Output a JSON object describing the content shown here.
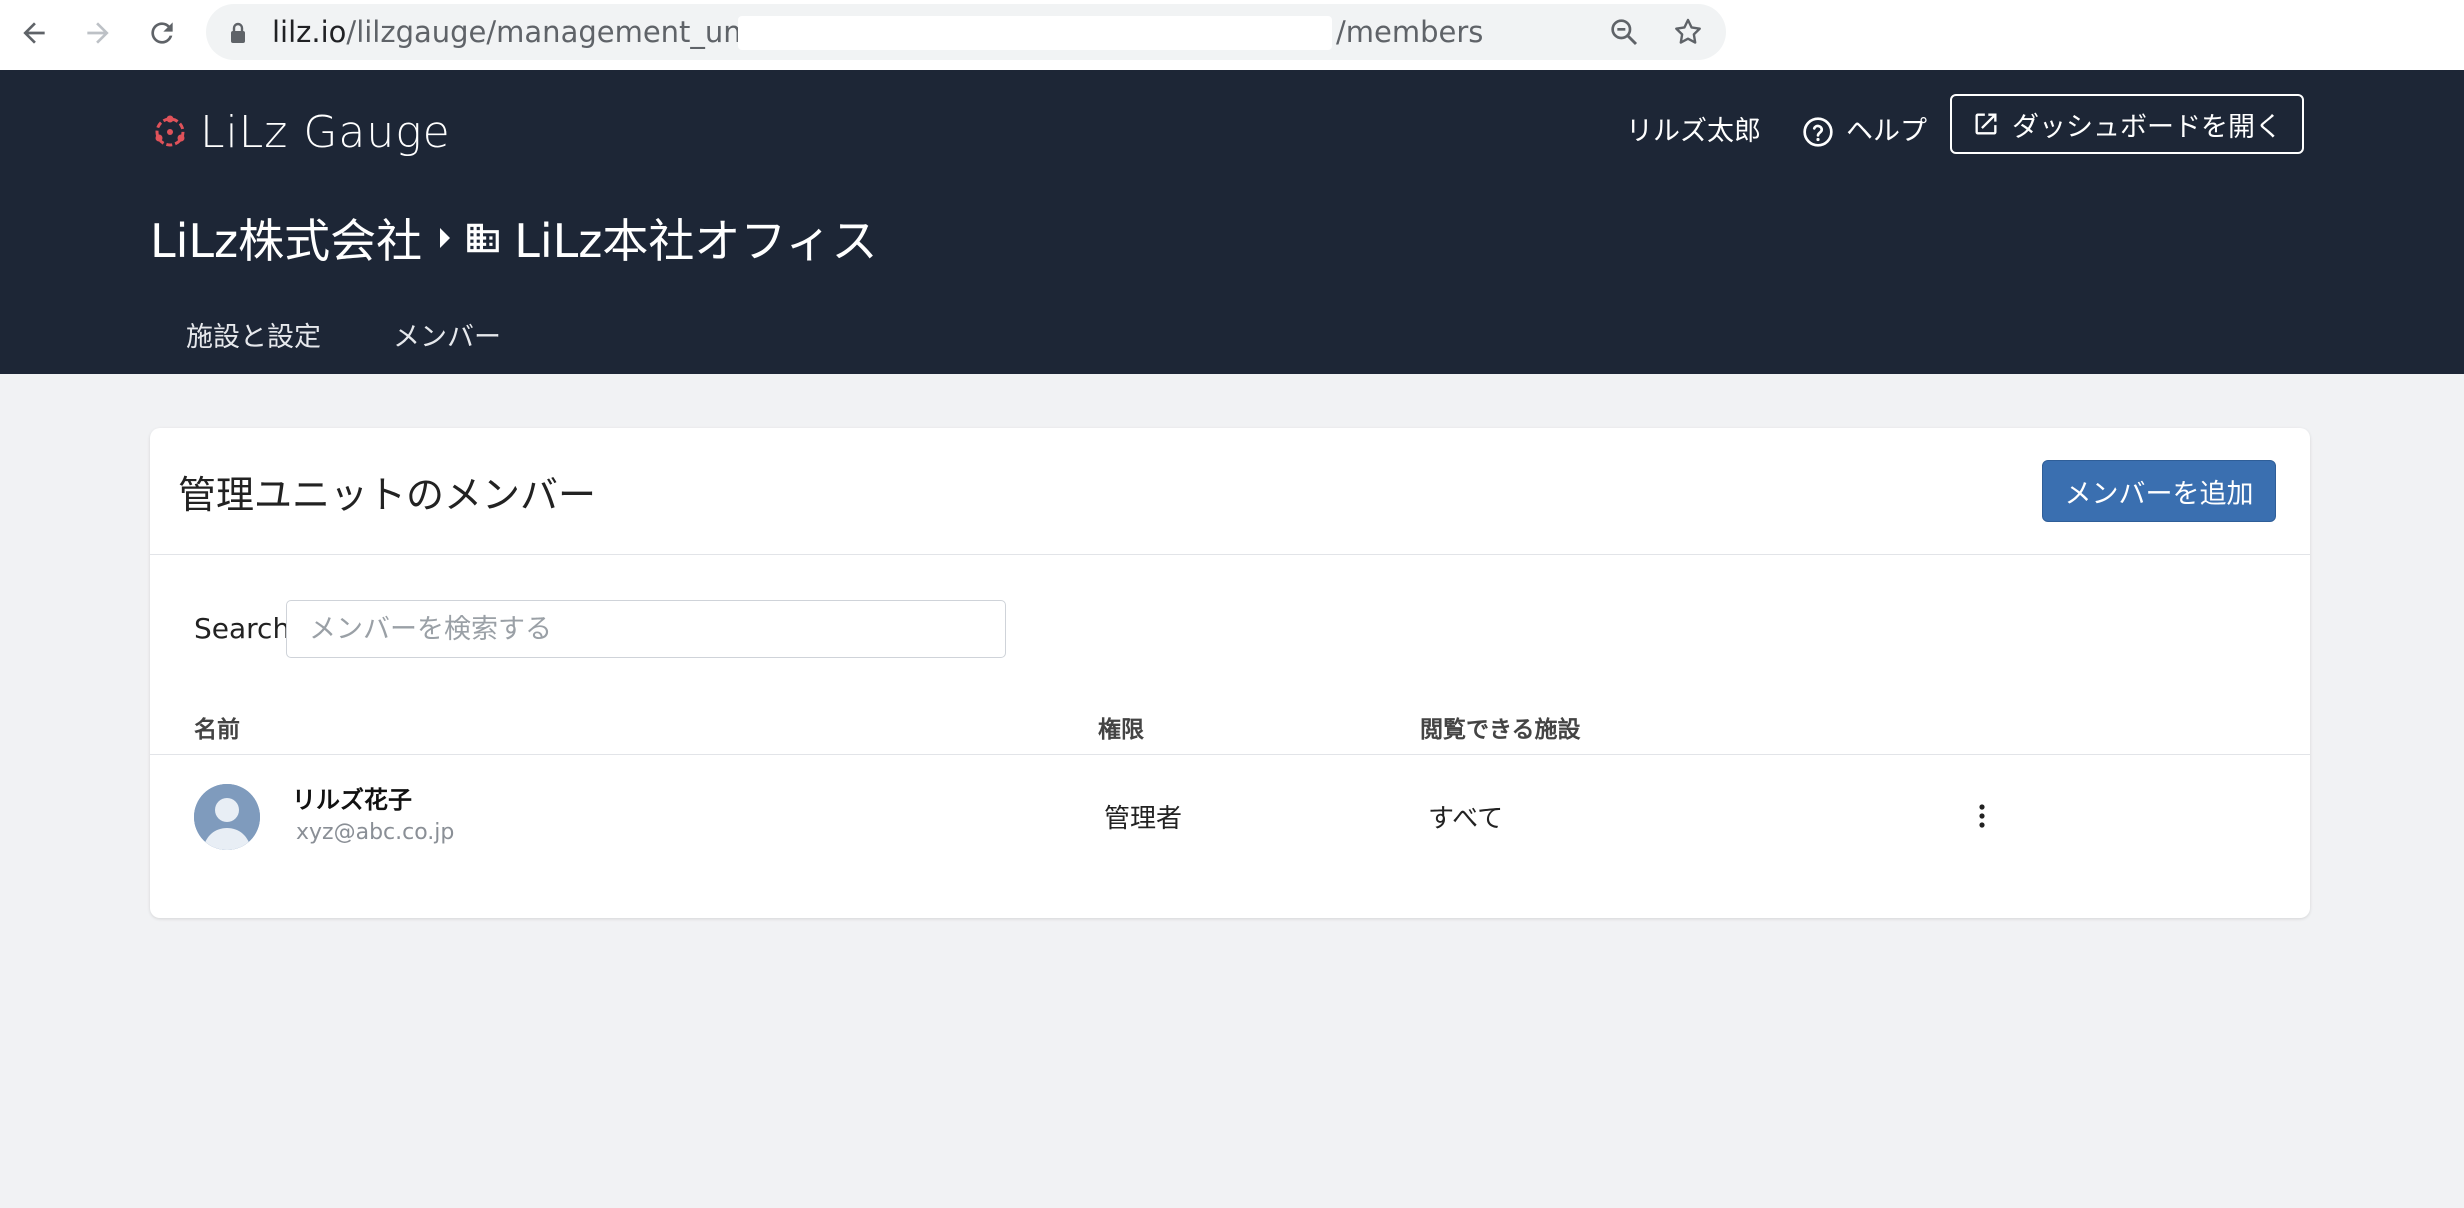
{
  "browser": {
    "url_host": "lilz.io",
    "url_path": "/lilzgauge/management_units/",
    "url_tail": "/members",
    "icons": [
      "back-icon",
      "forward-icon",
      "reload-icon",
      "lock-icon",
      "zoom-icon",
      "star-icon"
    ]
  },
  "header": {
    "logo_text": "LiLz Gauge",
    "user_name": "リルズ太郎",
    "help_label": "ヘルプ",
    "dashboard_label": "ダッシュボードを開く",
    "colors": {
      "background": "#1d2636",
      "logo_accent": "#e0525a"
    }
  },
  "breadcrumb": {
    "organization": "LiLz株式会社",
    "unit": "LiLz本社オフィス"
  },
  "tabs": [
    {
      "label": "施設と設定"
    },
    {
      "label": "メンバー"
    }
  ],
  "card": {
    "title": "管理ユニットのメンバー",
    "add_button_label": "メンバーを追加",
    "search": {
      "label": "Search",
      "placeholder": "メンバーを検索する",
      "value": ""
    },
    "columns": [
      "名前",
      "権限",
      "閲覧できる施設"
    ],
    "members": [
      {
        "name": "リルズ花子",
        "email": "xyz@abc.co.jp",
        "role": "管理者",
        "facilities": "すべて"
      }
    ]
  },
  "colors": {
    "primary_button": "#3a6fb0",
    "page_background": "#f1f2f4"
  }
}
